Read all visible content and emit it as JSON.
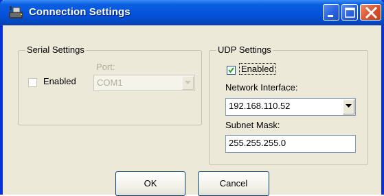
{
  "window": {
    "title": "Connection Settings",
    "icon": "app-icon",
    "controls": [
      "minimize-icon",
      "maximize-icon",
      "close-icon"
    ]
  },
  "serial": {
    "legend": "Serial Settings",
    "enabled_label": "Enabled",
    "enabled_checked": false,
    "port_label": "Port:",
    "port_value": "COM1"
  },
  "udp": {
    "legend": "UDP Settings",
    "enabled_label": "Enabled",
    "enabled_checked": true,
    "network_interface_label": "Network Interface:",
    "network_interface_value": "192.168.110.52",
    "subnet_mask_label": "Subnet Mask:",
    "subnet_mask_value": "255.255.255.0"
  },
  "buttons": {
    "ok": "OK",
    "cancel": "Cancel"
  },
  "colors": {
    "titlebar": "#0551da",
    "dialog_bg": "#ece9d8",
    "close_button": "#d9532f"
  }
}
